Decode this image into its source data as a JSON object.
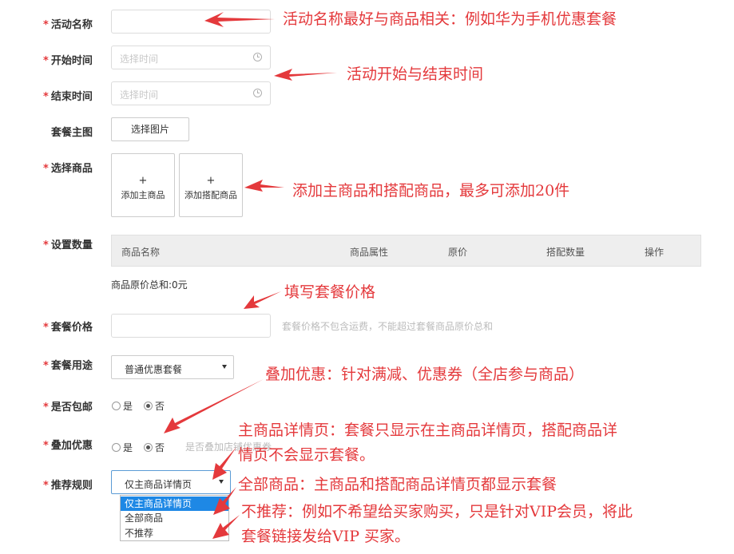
{
  "form": {
    "activity_name": {
      "label": "活动名称",
      "required": "*"
    },
    "start_time": {
      "label": "开始时间",
      "required": "*",
      "placeholder": "选择时间"
    },
    "end_time": {
      "label": "结束时间",
      "required": "*",
      "placeholder": "选择时间"
    },
    "main_image": {
      "label": "套餐主图",
      "button": "选择图片"
    },
    "select_goods": {
      "label": "选择商品",
      "required": "*",
      "add_main_plus": "+",
      "add_main": "添加主商品",
      "add_match_plus": "+",
      "add_match": "添加搭配商品"
    },
    "set_quantity": {
      "label": "设置数量",
      "required": "*",
      "columns": [
        "商品名称",
        "商品属性",
        "原价",
        "搭配数量",
        "操作"
      ],
      "total": "商品原价总和:0元"
    },
    "package_price": {
      "label": "套餐价格",
      "required": "*",
      "hint": "套餐价格不包含运费，不能超过套餐商品原价总和"
    },
    "package_usage": {
      "label": "套餐用途",
      "required": "*",
      "selected": "普通优惠套餐"
    },
    "free_shipping": {
      "label": "是否包邮",
      "required": "*",
      "yes": "是",
      "no": "否",
      "selected": "否"
    },
    "stack_discount": {
      "label": "叠加优惠",
      "required": "*",
      "yes": "是",
      "no": "否",
      "selected": "否",
      "hint": "是否叠加店铺优惠券"
    },
    "recommend_rule": {
      "label": "推荐规则",
      "required": "*",
      "selected": "仅主商品详情页",
      "options": [
        "仅主商品详情页",
        "全部商品",
        "不推荐"
      ]
    }
  },
  "annotations": {
    "name_tip": "活动名称最好与商品相关：例如华为手机优惠套餐",
    "time_tip": "活动开始与结束时间",
    "goods_tip": "添加主商品和搭配商品，最多可添加20件",
    "price_tip": "填写套餐价格",
    "stack_tip": "叠加优惠：针对满减、优惠券（全店参与商品）",
    "main_detail_tip_line1": "主商品详情页：套餐只显示在主商品详情页，搭配商品详",
    "main_detail_tip_line2": "情页不会显示套餐。",
    "all_goods_tip": "全部商品：主商品和搭配商品详情页都显示套餐",
    "no_recommend_tip_line1": "不推荐：例如不希望给买家购买，只是针对VIP会员，将此",
    "no_recommend_tip_line2": "套餐链接发给VIP 买家。"
  },
  "colors": {
    "annotation": "#e4393c",
    "selected_option": "#1e88e5"
  }
}
